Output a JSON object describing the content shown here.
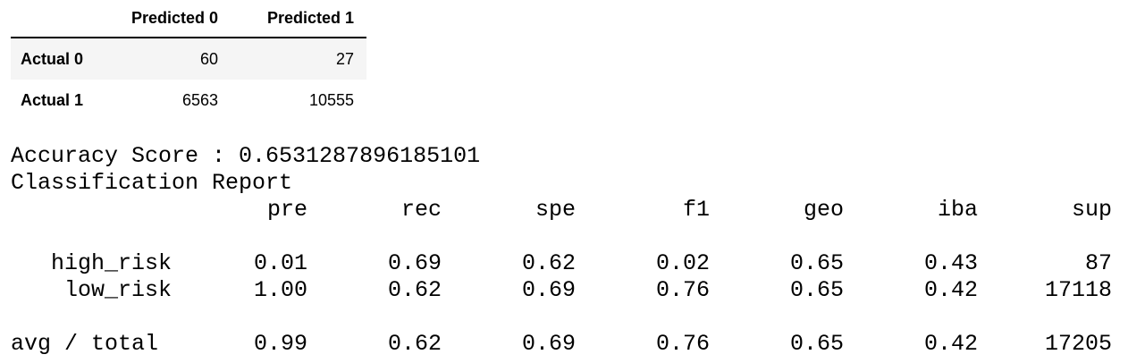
{
  "confusion_matrix": {
    "columns": [
      "Predicted 0",
      "Predicted 1"
    ],
    "rows": [
      {
        "label": "Actual 0",
        "values": [
          "60",
          "27"
        ]
      },
      {
        "label": "Actual 1",
        "values": [
          "6563",
          "10555"
        ]
      }
    ]
  },
  "accuracy_line": "Accuracy Score : 0.6531287896185101",
  "report_title": "Classification Report",
  "report": {
    "headers": [
      "pre",
      "rec",
      "spe",
      "f1",
      "geo",
      "iba",
      "sup"
    ],
    "rows": [
      {
        "label": "high_risk",
        "values": [
          "0.01",
          "0.69",
          "0.62",
          "0.02",
          "0.65",
          "0.43",
          "87"
        ]
      },
      {
        "label": "low_risk",
        "values": [
          "1.00",
          "0.62",
          "0.69",
          "0.76",
          "0.65",
          "0.42",
          "17118"
        ]
      }
    ],
    "total": {
      "label": "avg / total",
      "values": [
        "0.99",
        "0.62",
        "0.69",
        "0.76",
        "0.65",
        "0.42",
        "17205"
      ]
    }
  }
}
